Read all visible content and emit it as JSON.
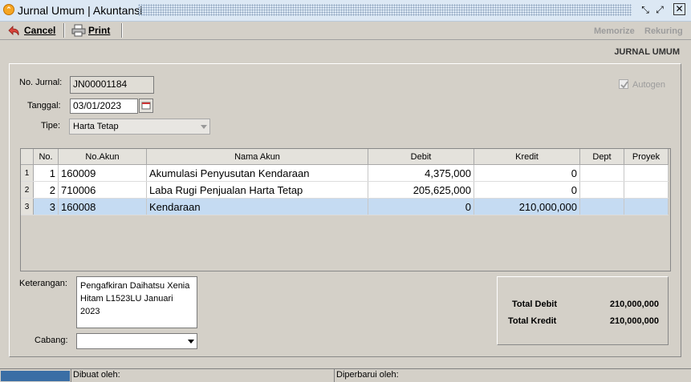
{
  "window": {
    "title": "Jurnal Umum | Akuntansi"
  },
  "toolbar": {
    "cancel_label": "Cancel",
    "print_label": "Print",
    "memorize_label": "Memorize",
    "rekuring_label": "Rekuring"
  },
  "header": {
    "section_title": "JURNAL UMUM"
  },
  "form": {
    "no_jurnal_label": "No. Jurnal:",
    "no_jurnal_value": "JN00001184",
    "tanggal_label": "Tanggal:",
    "tanggal_value": "03/01/2023",
    "tipe_label": "Tipe:",
    "tipe_value": "Harta Tetap",
    "autogen_label": "Autogen",
    "keterangan_label": "Keterangan:",
    "keterangan_value": "Pengafkiran Daihatsu Xenia Hitam L1523LU Januari 2023",
    "cabang_label": "Cabang:",
    "cabang_value": ""
  },
  "grid": {
    "columns": [
      "No.",
      "No.Akun",
      "Nama Akun",
      "Debit",
      "Kredit",
      "Dept",
      "Proyek"
    ],
    "rows": [
      {
        "row": "1",
        "no": "1",
        "akun": "160009",
        "nama": "Akumulasi Penyusutan Kendaraan",
        "debit": "4,375,000",
        "kredit": "0",
        "dept": "",
        "proyek": ""
      },
      {
        "row": "2",
        "no": "2",
        "akun": "710006",
        "nama": "Laba Rugi Penjualan Harta Tetap",
        "debit": "205,625,000",
        "kredit": "0",
        "dept": "",
        "proyek": ""
      },
      {
        "row": "3",
        "no": "3",
        "akun": "160008",
        "nama": "Kendaraan",
        "debit": "0",
        "kredit": "210,000,000",
        "dept": "",
        "proyek": ""
      }
    ]
  },
  "totals": {
    "debit_label": "Total Debit",
    "debit_value": "210,000,000",
    "kredit_label": "Total Kredit",
    "kredit_value": "210,000,000"
  },
  "status": {
    "dibuat_label": "Dibuat oleh:",
    "diperbarui_label": "Diperbarui oleh:"
  }
}
